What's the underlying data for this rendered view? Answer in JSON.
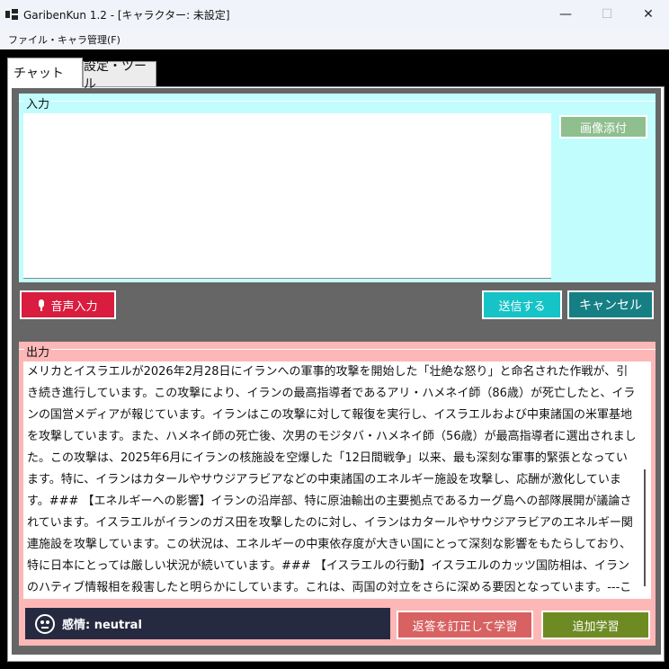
{
  "window": {
    "title": "GaribenKun 1.2 - [キャラクター: 未設定]",
    "minimize": "—",
    "maximize": "☐",
    "close": "✕"
  },
  "menu": {
    "file": "ファイル・キャラ管理(F)"
  },
  "tabs": [
    {
      "label": "チャット",
      "active": true
    },
    {
      "label": "設定・ツール",
      "active": false
    }
  ],
  "input_group": {
    "legend": "入力",
    "text_value": "",
    "attach_label": "画像添付"
  },
  "actions": {
    "voice_label": "音声入力",
    "send_label": "送信する",
    "cancel_label": "キャンセル"
  },
  "output_group": {
    "legend": "出力",
    "text": "メリカとイスラエルが2026年2月28日にイランへの軍事的攻撃を開始した「壮絶な怒り」と命名された作戦が、引き続き進行しています。この攻撃により、イランの最高指導者であるアリ・ハメネイ師（86歳）が死亡したと、イランの国営メディアが報じています。イランはこの攻撃に対して報復を実行し、イスラエルおよび中東諸国の米軍基地を攻撃しています。また、ハメネイ師の死亡後、次男のモジタバ・ハメネイ師（56歳）が最高指導者に選出されました。この攻撃は、2025年6月にイランの核施設を空爆した「12日間戦争」以来、最も深刻な軍事的緊張となっています。特に、イランはカタールやサウジアラビアなどの中東諸国のエネルギー施設を攻撃し、応酬が激化しています。### 【エネルギーへの影響】イランの沿岸部、特に原油輸出の主要拠点であるカーグ島への部隊展開が議論されています。イスラエルがイランのガス田を攻撃したのに対し、イランはカタールやサウジアラビアのエネルギー関連施設を攻撃しています。この状況は、エネルギーの中東依存度が大きい国にとって深刻な影響をもたらしており、特に日本にとっては厳しい状況が続いています。### 【イスラエルの行動】イスラエルのカッツ国防相は、イランのハティブ情報相を殺害したと明らかにしています。これは、両国の対立をさらに深める要因となっています。---このように、イラン情勢は"
  },
  "emotion": {
    "label": "感情: neutral"
  },
  "feedback": {
    "correct_label": "返答を訂正して学習",
    "add_label": "追加学習"
  },
  "colors": {
    "input_bg": "#c2fdfd",
    "output_bg": "#feb7b7",
    "voice": "#d81d3e",
    "send": "#16c3c7",
    "cancel": "#157f84",
    "correct": "#d86262",
    "add": "#6d8b22"
  }
}
